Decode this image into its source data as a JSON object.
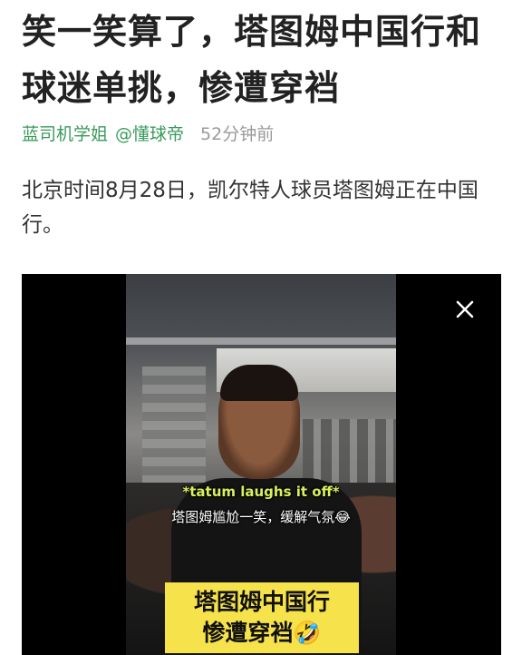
{
  "article": {
    "title": "笑一笑算了，塔图姆中国行和球迷单挑，惨遭穿裆",
    "source": "蓝司机学姐",
    "author": "@懂球帝",
    "time_ago": "52分钟前",
    "body": "北京时间8月28日，凯尔特人球员塔图姆正在中国行。"
  },
  "video": {
    "caption_en": "*tatum laughs it off*",
    "caption_zh": "塔图姆尴尬一笑，缓解气氛😂",
    "banner_line1": "塔图姆中国行",
    "banner_line2": "惨遭穿裆🤣",
    "close_icon": "close-icon"
  },
  "colors": {
    "source_green": "#3a9a5c",
    "time_gray": "#9a9a9a",
    "caption_yellow": "#d8f05a",
    "banner_yellow": "#f6e24a"
  }
}
